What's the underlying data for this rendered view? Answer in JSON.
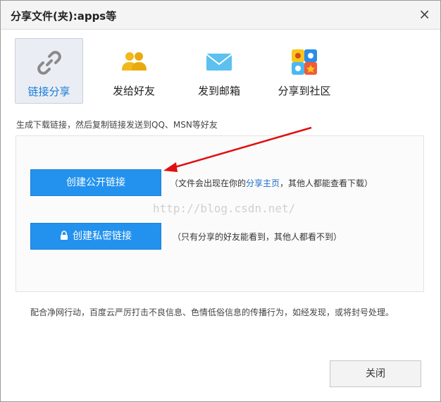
{
  "dialog": {
    "title": "分享文件(夹):apps等",
    "close_icon": "×",
    "tabs": [
      {
        "label": "链接分享",
        "icon": "link-icon",
        "active": true
      },
      {
        "label": "发给好友",
        "icon": "friends-icon",
        "active": false
      },
      {
        "label": "发到邮箱",
        "icon": "mail-icon",
        "active": false
      },
      {
        "label": "分享到社区",
        "icon": "community-icon",
        "active": false
      }
    ],
    "description": "生成下载链接，然后复制链接发送到QQ、MSN等好友",
    "public_button": "创建公开链接",
    "public_note_prefix": "（文件会出现在你的",
    "public_note_link": "分享主页",
    "public_note_suffix": "，其他人都能查看下载）",
    "private_button": "创建私密链接",
    "private_note": "（只有分享的好友能看到，其他人都看不到）",
    "watermark": "http://blog.csdn.net/",
    "footer_note": "配合净网行动，百度云严厉打击不良信息、色情低俗信息的传播行为，如经发现，或将封号处理。",
    "close_button": "关闭"
  },
  "colors": {
    "primary_blue": "#2392ee",
    "link_blue": "#1a6bc8",
    "arrow_red": "#e01010"
  }
}
